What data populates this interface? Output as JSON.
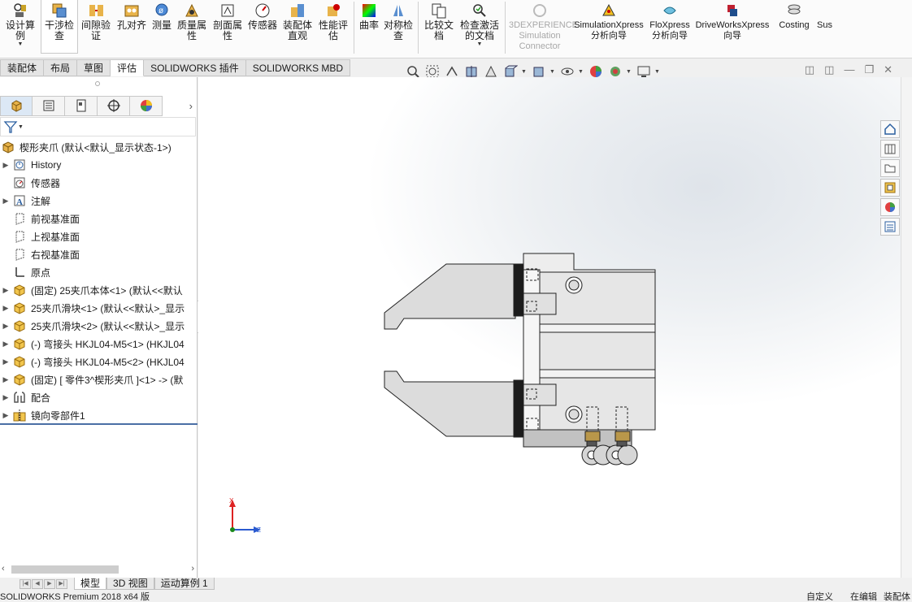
{
  "app": {
    "title": "SOLIDWORKS Premium 2018 x64 版"
  },
  "ribbon": {
    "buttons": [
      {
        "label": "设计算例",
        "icon": "design-study-icon"
      },
      {
        "label": "干涉检查",
        "icon": "interference-check-icon"
      },
      {
        "label": "间隙验证",
        "icon": "clearance-verification-icon"
      },
      {
        "label": "孔对齐",
        "icon": "hole-alignment-icon"
      },
      {
        "label": "测量",
        "icon": "measure-icon"
      },
      {
        "label": "质量属性",
        "icon": "mass-properties-icon"
      },
      {
        "label": "剖面属性",
        "icon": "section-properties-icon"
      },
      {
        "label": "传感器",
        "icon": "sensor-icon"
      },
      {
        "label": "装配体直观",
        "icon": "assembly-visualization-icon"
      },
      {
        "label": "性能评估",
        "icon": "performance-evaluation-icon"
      },
      {
        "label": "曲率",
        "icon": "curvature-icon"
      },
      {
        "label": "对称检查",
        "icon": "symmetry-check-icon"
      },
      {
        "label": "比较文档",
        "icon": "compare-documents-icon"
      },
      {
        "label": "检查激活的文档",
        "icon": "check-active-document-icon"
      },
      {
        "label": "3DEXPERIENCE Simulation Connector",
        "icon": "3dexperience-connector-icon"
      },
      {
        "label": "SimulationXpress 分析向导",
        "icon": "simulationxpress-icon"
      },
      {
        "label": "FloXpress 分析向导",
        "icon": "floxpress-icon"
      },
      {
        "label": "DriveWorksXpress 向导",
        "icon": "driveworksxpress-icon"
      },
      {
        "label": "Costing",
        "icon": "costing-icon"
      },
      {
        "label": "Sus",
        "icon": "sustainability-icon"
      }
    ]
  },
  "cmtabs": [
    "装配体",
    "布局",
    "草图",
    "评估",
    "SOLIDWORKS 插件",
    "SOLIDWORKS MBD"
  ],
  "cmtab_selected": "评估",
  "tree": {
    "root": "楔形夹爪 (默认<默认_显示状态-1>)",
    "items": [
      {
        "label": "History",
        "expandable": true,
        "icon": "history-icon"
      },
      {
        "label": "传感器",
        "expandable": false,
        "icon": "sensor-icon"
      },
      {
        "label": "注解",
        "expandable": true,
        "icon": "annotation-icon"
      },
      {
        "label": "前视基准面",
        "expandable": false,
        "icon": "plane-icon"
      },
      {
        "label": "上视基准面",
        "expandable": false,
        "icon": "plane-icon"
      },
      {
        "label": "右视基准面",
        "expandable": false,
        "icon": "plane-icon"
      },
      {
        "label": "原点",
        "expandable": false,
        "icon": "origin-icon"
      },
      {
        "label": "(固定) 25夹爪本体<1> (默认<<默认",
        "expandable": true,
        "icon": "part-icon"
      },
      {
        "label": "25夹爪滑块<1> (默认<<默认>_显示",
        "expandable": true,
        "icon": "part-icon"
      },
      {
        "label": "25夹爪滑块<2> (默认<<默认>_显示",
        "expandable": true,
        "icon": "part-icon"
      },
      {
        "label": "(-) 弯接头 HKJL04-M5<1> (HKJL04",
        "expandable": true,
        "icon": "part-icon"
      },
      {
        "label": "(-) 弯接头 HKJL04-M5<2> (HKJL04",
        "expandable": true,
        "icon": "part-icon"
      },
      {
        "label": "(固定) [ 零件3^楔形夹爪 ]<1> -> (默",
        "expandable": true,
        "icon": "part-icon"
      },
      {
        "label": "配合",
        "expandable": true,
        "icon": "mates-icon"
      },
      {
        "label": "镜向零部件1",
        "expandable": true,
        "icon": "mirror-component-icon"
      }
    ]
  },
  "bottom_tabs": [
    "模型",
    "3D 视图",
    "运动算例 1"
  ],
  "bottom_tab_selected": "模型",
  "status": {
    "left": "SOLIDWORKS Premium 2018 x64 版",
    "custom": "自定义",
    "editing": "在编辑",
    "assembly": "装配体"
  },
  "triad": {
    "x": "X",
    "z": "Z"
  },
  "colors": {
    "accent": "#4a6fa5",
    "part_gray": "#d9d9d9",
    "part_dark": "#1a1a1a"
  }
}
